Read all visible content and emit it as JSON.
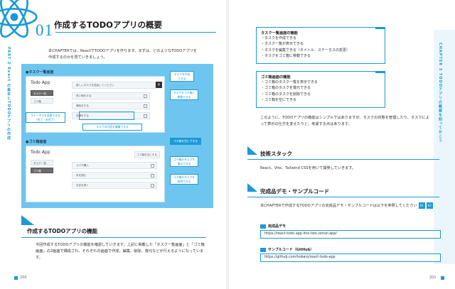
{
  "left": {
    "side_label": "PART 2 React の基本とTODOアプリの作成",
    "chapter_number": "01",
    "chapter_title": "作成するTODOアプリの概要",
    "intro": "本CHAPTERでは、ReactでTODOアプリを作ります。まずは、どのようなTODOアプリを作成するのかを見ていきましょう。",
    "mockup": {
      "list_heading": "●タスク一覧画面",
      "trash_heading": "●ゴミ箱画面",
      "app_title": "Todo App",
      "nav_tasks": "タスク一覧",
      "nav_trash": "ゴミ箱",
      "input_placeholder": "新しいタスクを追加してください",
      "task_rows": [
        "買い物をする",
        "掃除をする",
        "洗濯をする"
      ],
      "trash_rows": [
        "スマホ購入",
        "本を読む",
        "日記を書く"
      ],
      "trash_action": "ゴミ箱を空にする",
      "callouts": {
        "create": "タスクを作成できる",
        "move_trash": "タスクをゴミ箱に移動できる",
        "toggle_status": "ステータスを変更できる（完了・未完了）",
        "edit_content": "タスクの内容を編集できる",
        "empty_trash": "ゴミ箱を空にできる",
        "restore": "ゴミ箱のタスクを復元できる",
        "delete": "ゴミ箱のタスクを削除できる"
      }
    },
    "section_title": "作成するTODOアプリの機能",
    "section_body": "今回作成するTODOアプリの機能を確認していきます。上記に掲載した「タスク一覧画面」と「ゴミ箱画面」の2画面で構成され、それぞれの画面で作成、編集、削除、復元などが行えるようになっています。",
    "page_number": "200"
  },
  "right": {
    "side_label": "CHAPTER 3 TODOアプリの概要を知っておこう",
    "box1": {
      "title": "タスク一覧画面の機能",
      "items": [
        "タスクを作成できる",
        "タスク一覧が表示できる",
        "タスクを編集できる（タイトル、ステータスの変更）",
        "タスクをゴミ箱に移動できる"
      ]
    },
    "box2": {
      "title": "ゴミ箱画面の機能",
      "items": [
        "ゴミ箱のタスク一覧を表示できる",
        "ゴミ箱のタスクを復元できる",
        "ゴミ箱のタスクを削除できる",
        "ゴミ箱を空にできる"
      ]
    },
    "paragraph": "このように、TODOアプリの機能はシンプルではありますが、タスクの状態を管理したり、タスクによって表示の仕方を変えたりと、考慮する点はあります。",
    "tech_title": "技術スタック",
    "tech_body": "React、Vite、Tailwind CSSを用いて開発していきます。",
    "demo_title": "完成品デモ・サンプルコード",
    "demo_body": "本CHAPTERで作成するTODOアプリの完成品デモ・サンプルコードは以下を参照してください",
    "demo_badges": [
      "01",
      "02"
    ],
    "demo_label": "完成品デモ",
    "demo_url": "https://react-todo-app-line-two.vercel.app/",
    "code_label": "サンプルコード（GitHub）",
    "code_url": "https://github.com/kobaro/react-todo-app",
    "page_number": "201"
  }
}
